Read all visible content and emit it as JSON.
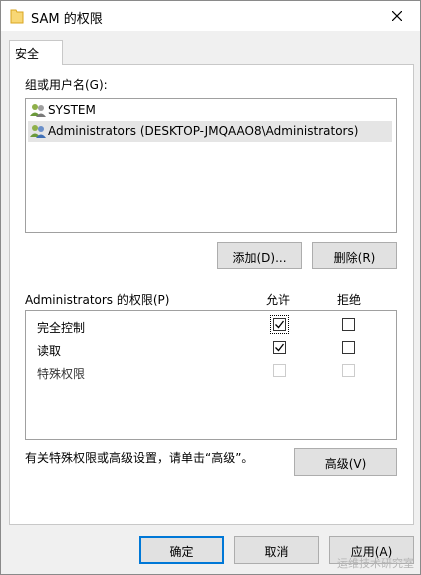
{
  "window": {
    "title": "SAM 的权限"
  },
  "tabs": [
    {
      "label": "安全"
    }
  ],
  "groups": {
    "label": "组或用户名(G):",
    "items": [
      {
        "name": "SYSTEM",
        "selected": false
      },
      {
        "name": "Administrators (DESKTOP-JMQAAO8\\Administrators)",
        "selected": true
      }
    ]
  },
  "buttons": {
    "add": "添加(D)...",
    "remove": "删除(R)",
    "advanced": "高级(V)",
    "ok": "确定",
    "cancel": "取消",
    "apply": "应用(A)"
  },
  "permissions": {
    "header": "Administrators 的权限(P)",
    "allow_header": "允许",
    "deny_header": "拒绝",
    "rows": [
      {
        "label": "完全控制",
        "allow": true,
        "deny": false,
        "enabled": true
      },
      {
        "label": "读取",
        "allow": true,
        "deny": false,
        "enabled": true
      },
      {
        "label": "特殊权限",
        "allow": false,
        "deny": false,
        "enabled": false
      }
    ]
  },
  "advanced_note": "有关特殊权限或高级设置，请单击“高级”。",
  "watermark": "运维技术研究室",
  "colors": {
    "focus_border": "#0078d7",
    "selection": "#e5e5e5",
    "window_bg": "#f0f0f0"
  }
}
